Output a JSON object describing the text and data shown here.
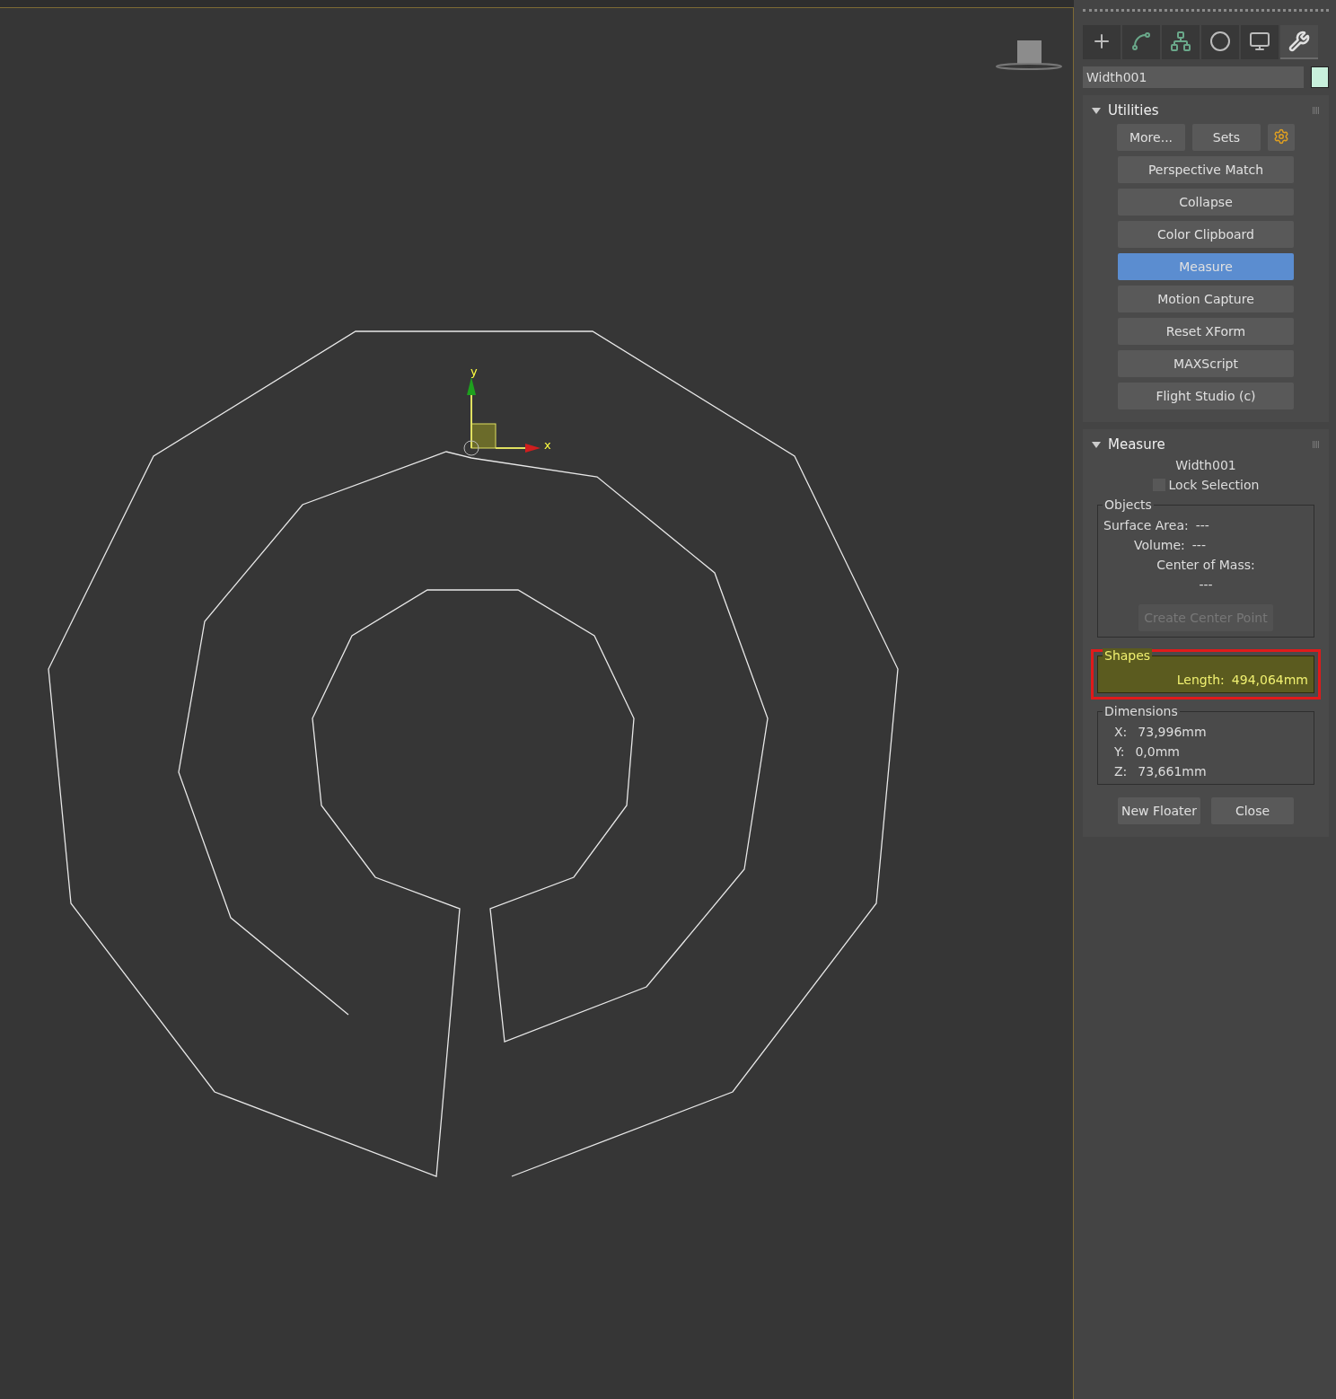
{
  "viewport": {
    "gizmo": {
      "y_label": "y",
      "x_label": "x"
    }
  },
  "command_panel": {
    "tabs": [
      {
        "kind": "create",
        "selected": false
      },
      {
        "kind": "modify",
        "selected": false
      },
      {
        "kind": "hierarchy",
        "selected": false
      },
      {
        "kind": "motion",
        "selected": false
      },
      {
        "kind": "display",
        "selected": false
      },
      {
        "kind": "utilities",
        "selected": true
      }
    ],
    "object_name": {
      "value": "Width001",
      "color": "#c8f0dc"
    },
    "utilities": {
      "title": "Utilities",
      "expanded": true,
      "top_buttons": [
        "More...",
        "Sets"
      ],
      "buttons": [
        {
          "label": "Perspective Match",
          "selected": false
        },
        {
          "label": "Collapse",
          "selected": false
        },
        {
          "label": "Color Clipboard",
          "selected": false
        },
        {
          "label": "Measure",
          "selected": true
        },
        {
          "label": "Motion Capture",
          "selected": false
        },
        {
          "label": "Reset XForm",
          "selected": false
        },
        {
          "label": "MAXScript",
          "selected": false
        },
        {
          "label": "Flight Studio (c)",
          "selected": false
        }
      ]
    },
    "measure": {
      "title": "Measure",
      "expanded": true,
      "object": "Width001",
      "lock_selection": {
        "label": "Lock Selection",
        "checked": false
      },
      "objects_group": {
        "title": "Objects",
        "surface_area": {
          "label": "Surface Area:",
          "value": "---"
        },
        "volume": {
          "label": "Volume:",
          "value": "---"
        },
        "center_of_mass": {
          "label": "Center of Mass:",
          "value": "---"
        },
        "create_center_point": {
          "label": "Create Center Point",
          "disabled": true
        }
      },
      "shapes_group": {
        "title": "Shapes",
        "highlighted": true,
        "length": {
          "label": "Length:",
          "value": "494,064mm"
        }
      },
      "dimensions_group": {
        "title": "Dimensions",
        "rows": [
          {
            "label": "X:",
            "value": "73,996mm"
          },
          {
            "label": "Y:",
            "value": "0,0mm"
          },
          {
            "label": "Z:",
            "value": "73,661mm"
          }
        ]
      },
      "buttons": [
        "New Floater",
        "Close"
      ]
    }
  }
}
